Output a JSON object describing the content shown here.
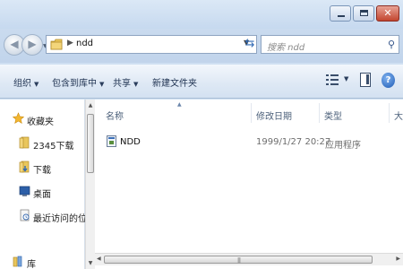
{
  "address_bar": {
    "path": "ndd",
    "search_placeholder": "搜索 ndd"
  },
  "toolbar": {
    "organize": "组织",
    "include_in_library": "包含到库中",
    "share": "共享",
    "new_folder": "新建文件夹"
  },
  "nav_pane": {
    "items": [
      {
        "label": "收藏夹",
        "icon": "star-icon"
      },
      {
        "label": "2345下载",
        "icon": "folder-icon"
      },
      {
        "label": "下载",
        "icon": "download-folder-icon"
      },
      {
        "label": "桌面",
        "icon": "desktop-icon"
      },
      {
        "label": "最近访问的位置",
        "icon": "recent-places-icon"
      },
      {
        "label": "库",
        "icon": "library-icon"
      }
    ]
  },
  "file_list": {
    "columns": [
      "名称",
      "修改日期",
      "类型",
      "大"
    ],
    "files": [
      {
        "name": "NDD",
        "modified": "1999/1/27 20:27",
        "type": "应用程序",
        "icon": "application-icon"
      }
    ]
  },
  "colors": {
    "titlebar": "#cfe0f2",
    "toolbar_text": "#1e3150",
    "header_text": "#4c607a",
    "close_button": "#c2452f"
  }
}
